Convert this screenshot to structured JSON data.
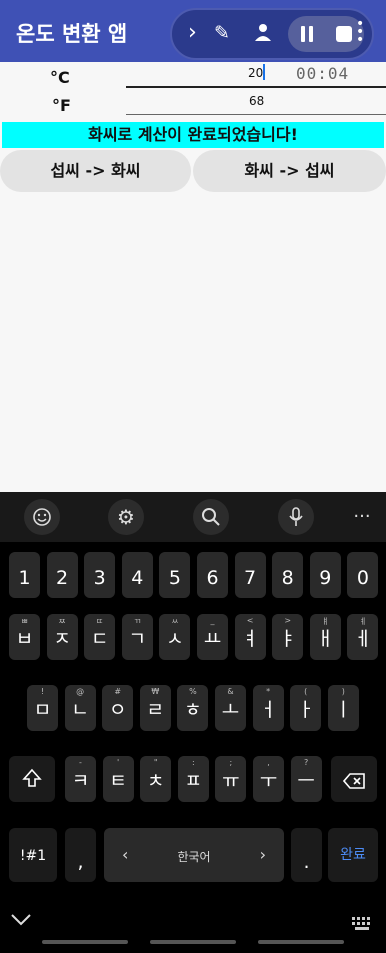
{
  "app": {
    "title": "온도 변환 앱"
  },
  "recorder": {
    "time": "00:04"
  },
  "form": {
    "celsius_label": "°C",
    "celsius_value": "20",
    "fahrenheit_label": "°F",
    "fahrenheit_value": "68"
  },
  "status_message": "화씨로 계산이 완료되었습니다!",
  "buttons": {
    "c_to_f": "섭씨 -> 화씨",
    "f_to_c": "화씨 -> 섭씨"
  },
  "keyboard": {
    "numbers": [
      "1",
      "2",
      "3",
      "4",
      "5",
      "6",
      "7",
      "8",
      "9",
      "0"
    ],
    "row1": [
      [
        "ㅂ",
        "ㅃ"
      ],
      [
        "ㅈ",
        "ㅉ"
      ],
      [
        "ㄷ",
        "ㄸ"
      ],
      [
        "ㄱ",
        "ㄲ"
      ],
      [
        "ㅅ",
        "ㅆ"
      ],
      [
        "ㅛ",
        "_"
      ],
      [
        "ㅕ",
        "<"
      ],
      [
        "ㅑ",
        ">"
      ],
      [
        "ㅐ",
        "ㅒ"
      ],
      [
        "ㅔ",
        "ㅖ"
      ]
    ],
    "row2": [
      [
        "ㅁ",
        "!"
      ],
      [
        "ㄴ",
        "@"
      ],
      [
        "ㅇ",
        "#"
      ],
      [
        "ㄹ",
        "₩"
      ],
      [
        "ㅎ",
        "%"
      ],
      [
        "ㅗ",
        "&"
      ],
      [
        "ㅓ",
        "*"
      ],
      [
        "ㅏ",
        "("
      ],
      [
        "ㅣ",
        ")"
      ]
    ],
    "row3": [
      [
        "ㅋ",
        "-"
      ],
      [
        "ㅌ",
        "'"
      ],
      [
        "ㅊ",
        "\""
      ],
      [
        "ㅍ",
        ":"
      ],
      [
        "ㅠ",
        ";"
      ],
      [
        "ㅜ",
        ","
      ],
      [
        "ㅡ",
        "?"
      ]
    ],
    "symbols_label": "!#1",
    "comma": ",",
    "language": "한국어",
    "period": ".",
    "done_label": "완료"
  },
  "colors": {
    "appbar": "#3f51b5",
    "status_bg": "#00ffff",
    "done_text": "#4d8cf5"
  }
}
